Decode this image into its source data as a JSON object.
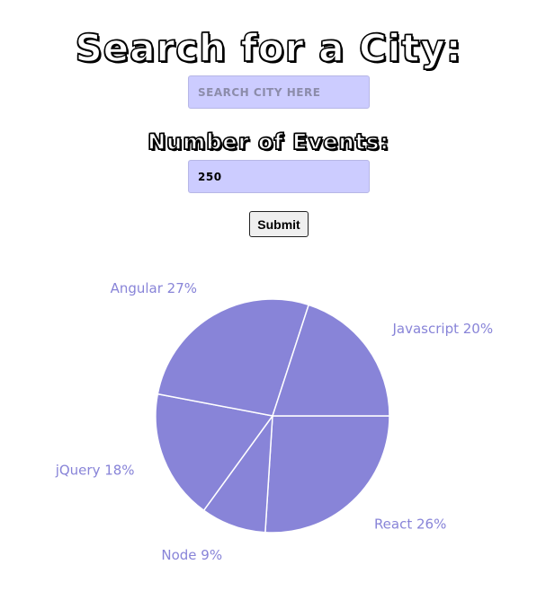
{
  "search": {
    "heading": "Search for a City:",
    "placeholder": "SEARCH CITY HERE",
    "value": ""
  },
  "events": {
    "heading": "Number of Events:",
    "value": "250"
  },
  "submit_label": "Submit",
  "colors": {
    "slice_fill": "#8884d8",
    "slice_stroke": "#ffffff",
    "label_color": "#8884d8",
    "input_bg": "#ccccff"
  },
  "chart_data": {
    "type": "pie",
    "slices": [
      {
        "label": "React",
        "value": 26
      },
      {
        "label": "Node",
        "value": 9
      },
      {
        "label": "jQuery",
        "value": 18
      },
      {
        "label": "Angular",
        "value": 27
      },
      {
        "label": "Javascript",
        "value": 20
      }
    ],
    "start_angle_deg": 0,
    "direction": "clockwise",
    "label_format": "{label} {value}%"
  }
}
